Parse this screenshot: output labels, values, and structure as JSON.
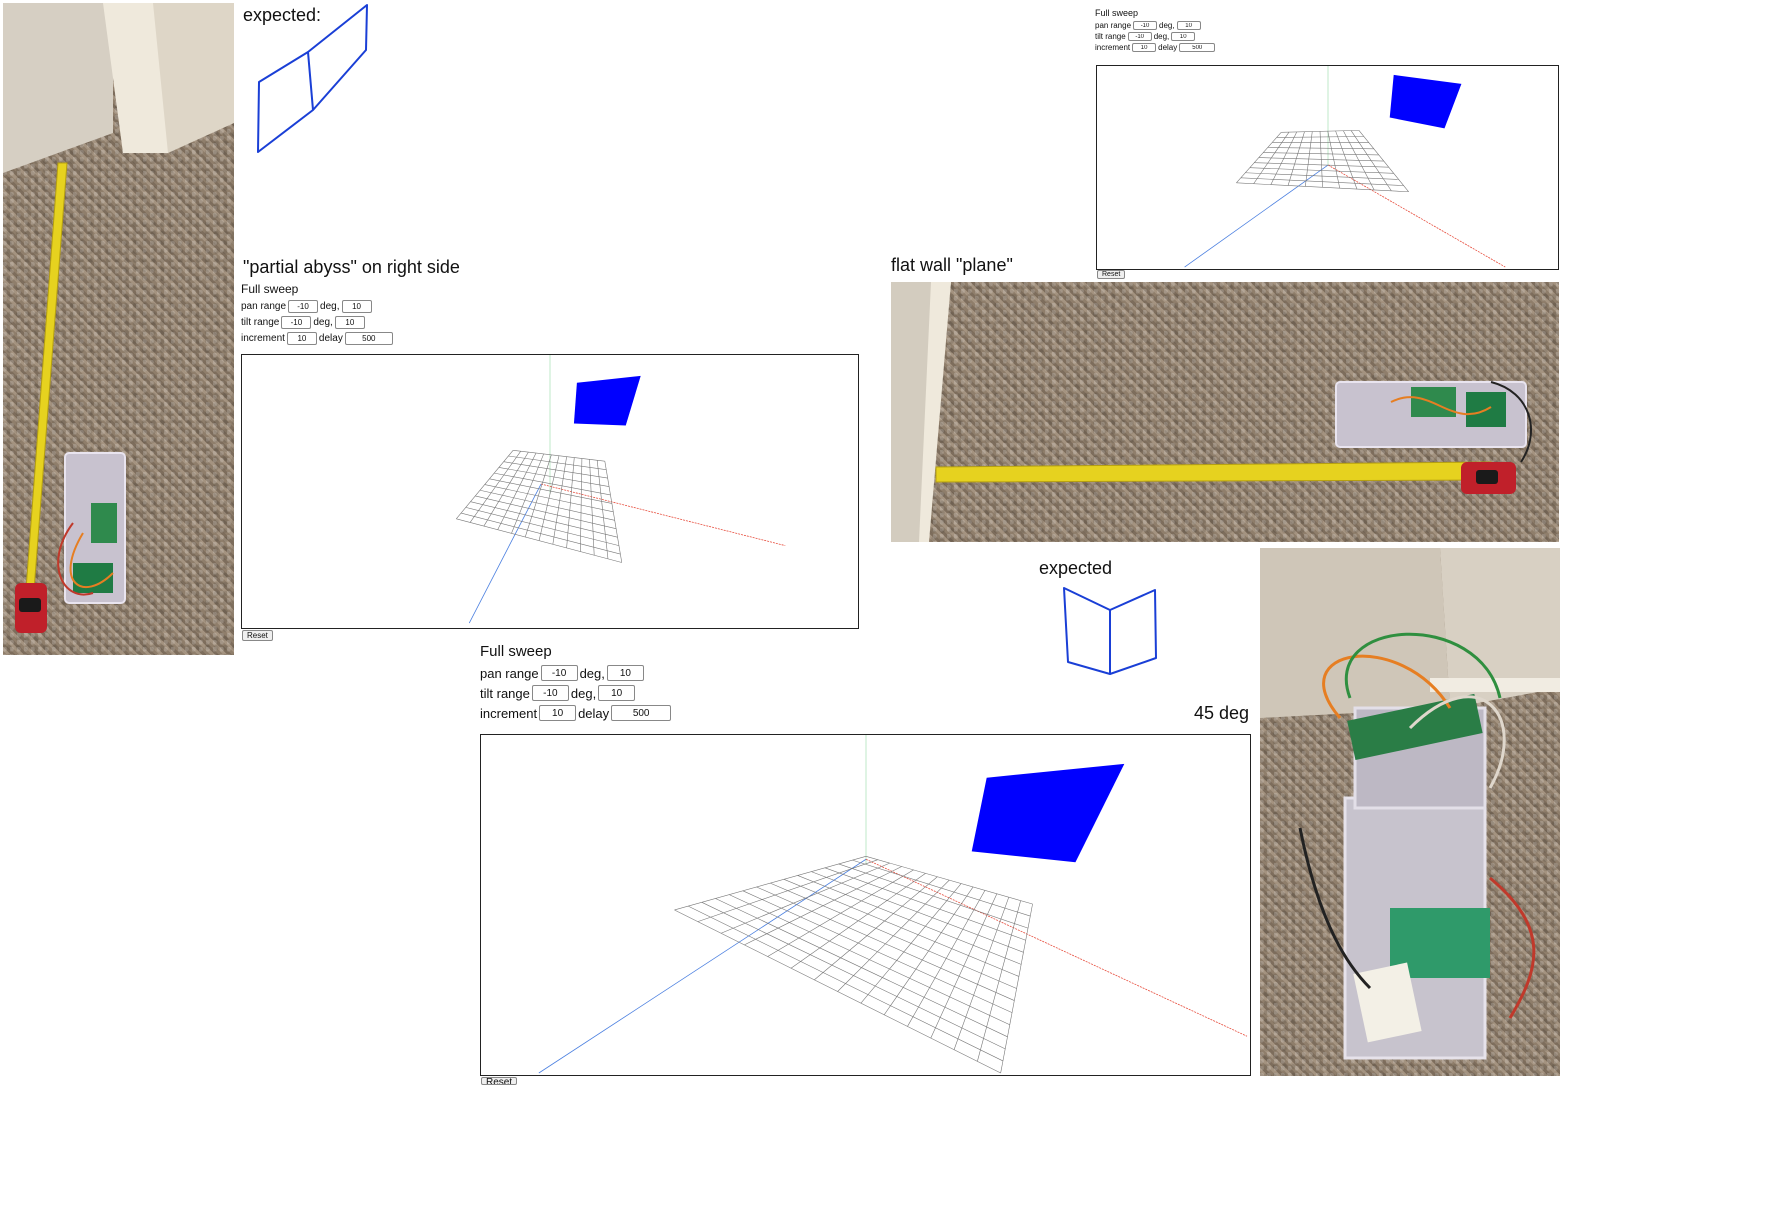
{
  "annotations": {
    "expected_top": "expected:",
    "partial_abyss": "\"partial abyss\" on right side",
    "flat_wall": "flat wall \"plane\"",
    "expected_mid": "expected",
    "angle": "45 deg"
  },
  "sweep_form": {
    "title": "Full sweep",
    "pan_label": "pan range",
    "pan_min": "-10",
    "pan_unit": "deg,",
    "pan_max": "10",
    "tilt_label": "tilt range",
    "tilt_min": "-10",
    "tilt_unit": "deg,",
    "tilt_max": "10",
    "increment_label": "increment",
    "increment_value": "10",
    "delay_label": "delay",
    "delay_value": "500",
    "reset_label": "Reset"
  },
  "colors": {
    "plane": "#0000ff",
    "sketch": "#1a3fd6",
    "x_axis": "#e74c3c",
    "z_axis": "#4a7fe0",
    "y_axis": "#2ecc71",
    "grid": "#777777"
  }
}
